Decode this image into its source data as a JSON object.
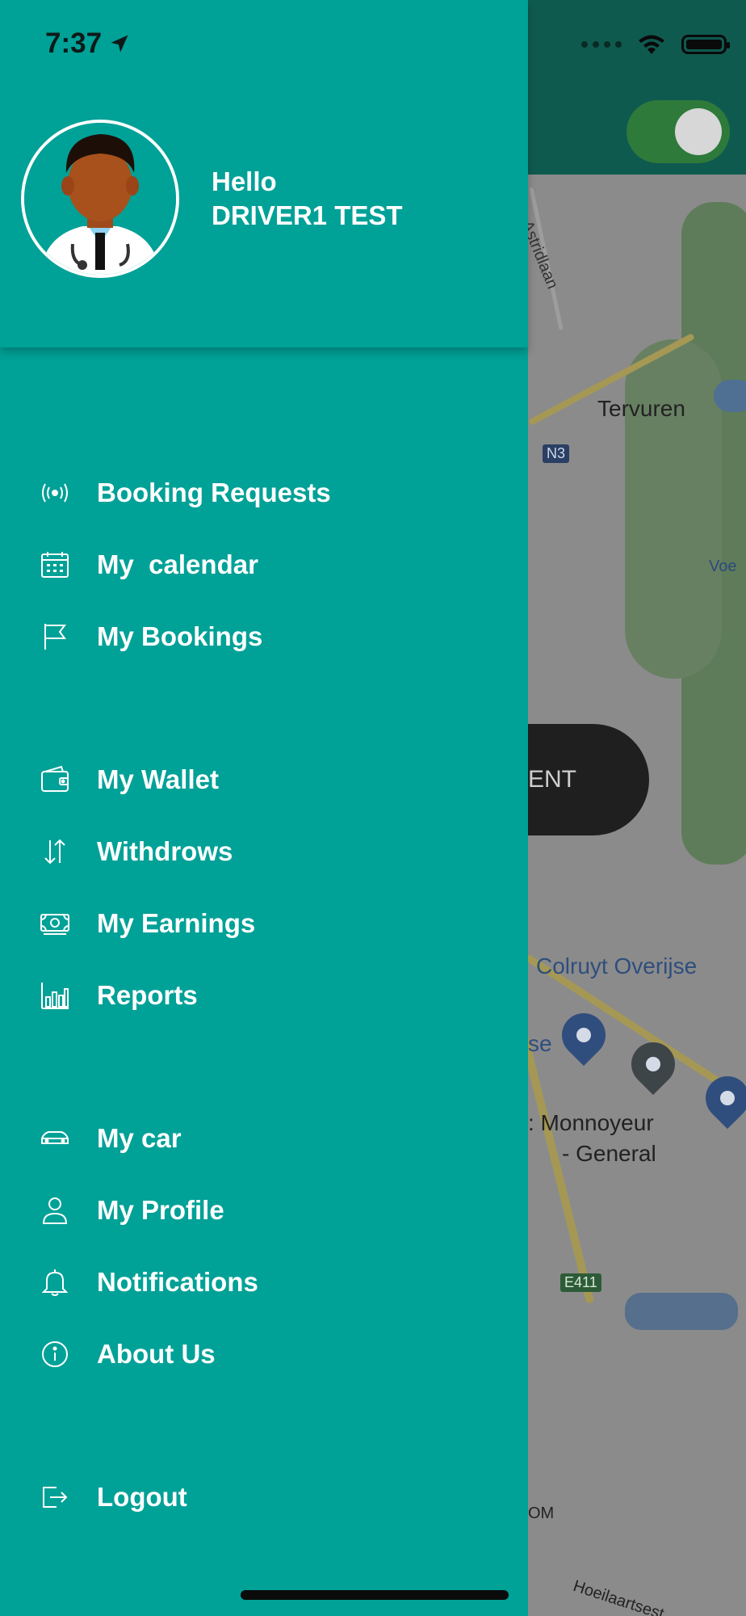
{
  "status_bar": {
    "time": "7:37"
  },
  "drawer": {
    "greeting": "Hello",
    "user_name": "DRIVER1 TEST",
    "menu_groups": [
      [
        {
          "label": "Booking Requests",
          "icon": "broadcast-icon"
        },
        {
          "label": "My  calendar",
          "icon": "calendar-icon"
        },
        {
          "label": "My Bookings",
          "icon": "flag-icon"
        }
      ],
      [
        {
          "label": "My Wallet",
          "icon": "wallet-icon"
        },
        {
          "label": "Withdrows",
          "icon": "transfer-arrows-icon"
        },
        {
          "label": "My Earnings",
          "icon": "cash-icon"
        },
        {
          "label": "Reports",
          "icon": "bar-chart-icon"
        }
      ],
      [
        {
          "label": "My car",
          "icon": "car-icon"
        },
        {
          "label": "My Profile",
          "icon": "user-icon"
        },
        {
          "label": "Notifications",
          "icon": "bell-icon"
        },
        {
          "label": "About Us",
          "icon": "info-icon"
        }
      ],
      [
        {
          "label": "Logout",
          "icon": "logout-icon"
        }
      ]
    ]
  },
  "map": {
    "labels": {
      "tervuren": "Tervuren",
      "astridlaan": "Astridlaan",
      "voe": "Voe",
      "colruyt": "Colruyt Overijse",
      "se": "se",
      "monnoyeur": ": Monnoyeur",
      "general": "- General",
      "om": "OM",
      "hoeilaart": "Hoeilaartsest"
    },
    "road_badges": {
      "n3": "N3",
      "e411": "E411"
    },
    "partial_button_text": "ENT",
    "toggle_on": true
  },
  "colors": {
    "drawer": "#00a197",
    "header_dark": "#0f5a4f",
    "text": "#ffffff"
  }
}
